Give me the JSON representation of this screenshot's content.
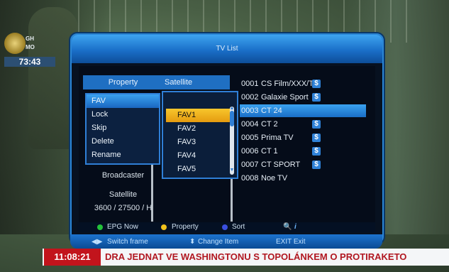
{
  "score_bug": {
    "team1": "GH",
    "team2": "MO",
    "clock": "73:43"
  },
  "window": {
    "title": "TV List"
  },
  "tabs": {
    "property": "Property",
    "satellite": "Satellite"
  },
  "property_menu": [
    "FAV",
    "Lock",
    "Skip",
    "Delete",
    "Rename"
  ],
  "property_menu_selected": 0,
  "fav_list": [
    "FAV1",
    "FAV2",
    "FAV3",
    "FAV4",
    "FAV5"
  ],
  "fav_selected": 0,
  "info": {
    "broadcaster": "Broadcaster",
    "satellite": "Satellite",
    "transponder": "3600 / 27500 / H"
  },
  "channels": [
    {
      "num": "0001",
      "name": "CS Film/XXX/Tes",
      "scrambled": "$"
    },
    {
      "num": "0002",
      "name": "Galaxie Sport",
      "scrambled": "$"
    },
    {
      "num": "0003",
      "name": "CT 24",
      "scrambled": ""
    },
    {
      "num": "0004",
      "name": "CT 2",
      "scrambled": "$"
    },
    {
      "num": "0005",
      "name": "Prima TV",
      "scrambled": "$"
    },
    {
      "num": "0006",
      "name": "CT 1",
      "scrambled": "$"
    },
    {
      "num": "0007",
      "name": "CT SPORT",
      "scrambled": "$"
    },
    {
      "num": "0008",
      "name": "Noe TV",
      "scrambled": ""
    }
  ],
  "channel_selected": 2,
  "footer": {
    "green": "EPG Now",
    "yellow": "Property",
    "blue": "Sort"
  },
  "nav": {
    "switch": "Switch frame",
    "change": "Change Item",
    "exit": "EXIT Exit"
  },
  "ticker": {
    "time": "11:08:21",
    "text": "DRA JEDNAT VE WASHINGTONU S TOPOLÁNKEM O PROTIRAKETO"
  },
  "colors": {
    "accent": "#1f6fc2",
    "highlight": "#f2b61c",
    "ticker_red": "#c2141c"
  }
}
